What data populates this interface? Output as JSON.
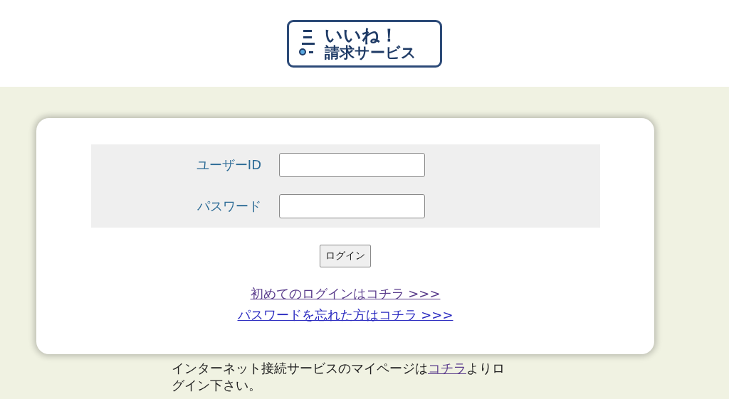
{
  "logo": {
    "line_1": "いいね！",
    "line_2": "請求サービス"
  },
  "login_form": {
    "fields": [
      {
        "label": "ユーザーID"
      },
      {
        "label": "パスワード"
      }
    ],
    "button": "ログイン",
    "links": [
      {
        "text": "初めてのログインはコチラ >>>",
        "visited": true
      },
      {
        "text": "パスワードを忘れた方はコチラ >>>",
        "visited": false
      }
    ]
  },
  "notice": {
    "before": "インターネット接続サービスのマイページは",
    "link": {
      "text": "コチラ",
      "visited": true
    },
    "after": "よりログイン下さい。"
  }
}
